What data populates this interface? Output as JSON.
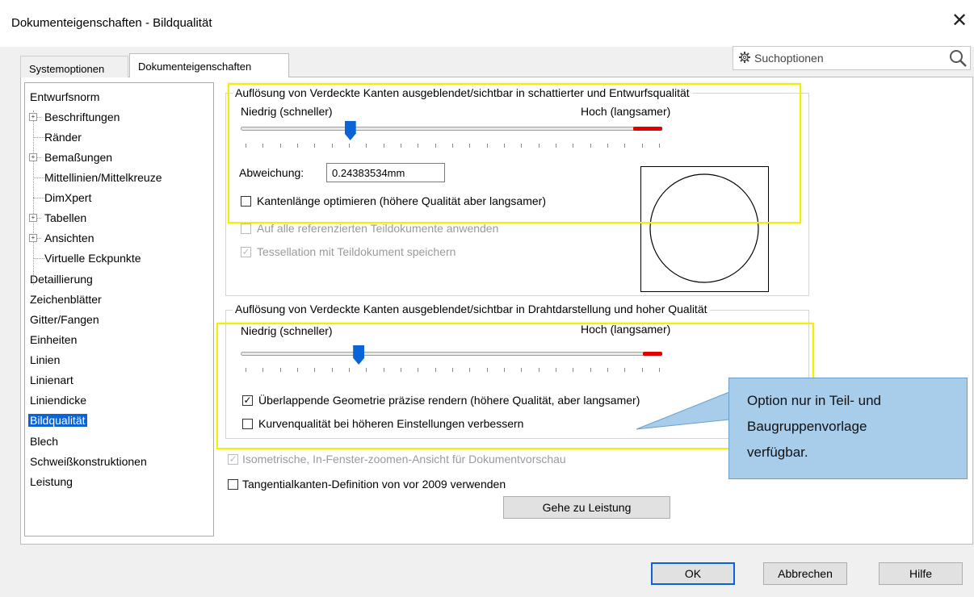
{
  "window": {
    "title": "Dokumenteigenschaften - Bildqualität",
    "close_glyph": "✕"
  },
  "tabs": [
    {
      "label": "Systemoptionen",
      "active": false
    },
    {
      "label": "Dokumenteigenschaften",
      "active": true
    }
  ],
  "search": {
    "placeholder": "Suchoptionen",
    "icon": "search-icon"
  },
  "tree": [
    {
      "label": "Entwurfsnorm",
      "level": 0
    },
    {
      "label": "Beschriftungen",
      "level": 1,
      "expandable": true
    },
    {
      "label": "Ränder",
      "level": 1
    },
    {
      "label": "Bemaßungen",
      "level": 1,
      "expandable": true
    },
    {
      "label": "Mittellinien/Mittelkreuze",
      "level": 1
    },
    {
      "label": "DimXpert",
      "level": 1
    },
    {
      "label": "Tabellen",
      "level": 1,
      "expandable": true
    },
    {
      "label": "Ansichten",
      "level": 1,
      "expandable": true
    },
    {
      "label": "Virtuelle Eckpunkte",
      "level": 1
    },
    {
      "label": "Detaillierung",
      "level": 0
    },
    {
      "label": "Zeichenblätter",
      "level": 0
    },
    {
      "label": "Gitter/Fangen",
      "level": 0
    },
    {
      "label": "Einheiten",
      "level": 0
    },
    {
      "label": "Linien",
      "level": 0
    },
    {
      "label": "Linienart",
      "level": 0
    },
    {
      "label": "Liniendicke",
      "level": 0
    },
    {
      "label": "Bildqualität",
      "level": 0,
      "selected": true
    },
    {
      "label": "Blech",
      "level": 0
    },
    {
      "label": "Schweißkonstruktionen",
      "level": 0
    },
    {
      "label": "Leistung",
      "level": 0
    }
  ],
  "group1": {
    "legend": "Auflösung von Verdeckte Kanten ausgeblendet/sichtbar in schattierter und Entwurfsqualität",
    "low_label": "Niedrig (schneller)",
    "high_label": "Hoch (langsamer)",
    "slider_value": 0.26,
    "deviation_label": "Abweichung:",
    "deviation_value": "0.24383534mm",
    "cb_optimize": {
      "label": "Kantenlänge optimieren (höhere Qualität aber langsamer)",
      "checked": false,
      "enabled": true
    },
    "cb_apply_all": {
      "label": "Auf alle referenzierten Teildokumente anwenden",
      "checked": false,
      "enabled": false
    },
    "cb_tessellation": {
      "label": "Tessellation mit Teildokument speichern",
      "checked": true,
      "enabled": false
    }
  },
  "group2": {
    "legend": "Auflösung von Verdeckte Kanten ausgeblendet/sichtbar in Drahtdarstellung und hoher Qualität",
    "low_label": "Niedrig (schneller)",
    "high_label": "Hoch (langsamer)",
    "slider_value": 0.28,
    "cb_overlap": {
      "label": "Überlappende Geometrie präzise rendern (höhere Qualität, aber langsamer)",
      "checked": true,
      "enabled": true
    },
    "cb_curve": {
      "label": "Kurvenqualität bei höheren Einstellungen verbessern",
      "checked": false,
      "enabled": true
    }
  },
  "cb_isometric": {
    "label": "Isometrische, In-Fenster-zoomen-Ansicht für Dokumentvorschau",
    "checked": true,
    "enabled": false
  },
  "cb_tangent": {
    "label": "Tangentialkanten-Definition von vor 2009 verwenden",
    "checked": false,
    "enabled": true
  },
  "goto_button": "Gehe zu Leistung",
  "buttons": {
    "ok": "OK",
    "cancel": "Abbrechen",
    "help": "Hilfe"
  },
  "callout": {
    "line1": "Option nur in Teil- und",
    "line2": "Baugruppenvorlage",
    "line3": "verfügbar."
  },
  "colors": {
    "accent": "#0a64d8",
    "highlight": "#f2f000",
    "callout": "#a8cdea",
    "slider_high": "#e00000"
  }
}
